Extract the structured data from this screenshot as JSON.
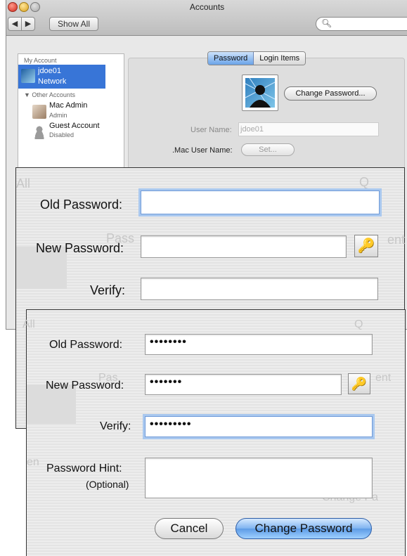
{
  "window": {
    "title": "Accounts"
  },
  "toolbar": {
    "back": "◀",
    "forward": "▶",
    "show_all": "Show All",
    "search_placeholder": ""
  },
  "accounts": {
    "my_account_header": "My Account",
    "selected": {
      "name": "jdoe01",
      "type": "Network"
    },
    "other_header": "▼ Other Accounts",
    "others": [
      {
        "name": "Mac Admin",
        "type": "Admin"
      },
      {
        "name": "Guest Account",
        "type": "Disabled"
      }
    ]
  },
  "panel": {
    "tabs": [
      "Password",
      "Login Items"
    ],
    "change_password_btn": "Change Password...",
    "user_name_label": "User Name:",
    "user_name_value": "jdoe01",
    "mac_user_label": ".Mac User Name:",
    "set_btn": "Set..."
  },
  "sheet_empty": {
    "old_label": "Old Password:",
    "new_label": "New Password:",
    "verify_label": "Verify:",
    "key_icon": "🔑",
    "ghost_show_all": "All",
    "ghost_search": "Q",
    "ghost_tab": "Pass",
    "ghost_side": "ent"
  },
  "sheet_filled": {
    "old_label": "Old Password:",
    "old_value": "••••••••",
    "new_label": "New Password:",
    "new_value": "•••••••",
    "verify_label": "Verify:",
    "verify_value": "•••••••••",
    "hint_label": "Password Hint:",
    "hint_sub": "(Optional)",
    "hint_value": "",
    "key_icon": "🔑",
    "cancel_btn": "Cancel",
    "change_btn": "Change Password",
    "ghost_show_all": "All",
    "ghost_search": "Q",
    "ghost_tab": "Pas",
    "ghost_side": "ent",
    "ghost_bottom": "en",
    "ghost_chg": "Change Pa"
  },
  "colors": {
    "selection": "#3875d7",
    "focus_ring": "#a9c8ef",
    "default_button": "#5d9be6"
  }
}
